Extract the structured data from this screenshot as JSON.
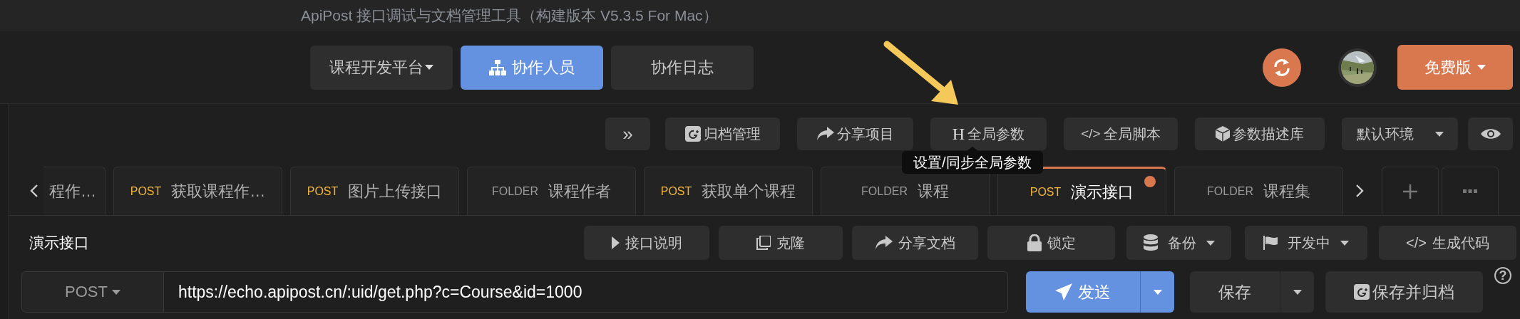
{
  "window": {
    "title": "ApiPost 接口调试与文档管理工具（构建版本 V5.3.5 For Mac）"
  },
  "header": {
    "project_menu": "课程开发平台",
    "buttons": [
      {
        "kind": "members",
        "label": "协作人员",
        "selected": true
      },
      {
        "kind": "log",
        "label": "协作日志",
        "selected": false
      }
    ],
    "plan_button": "免费版"
  },
  "toolbar": [
    {
      "kind": "expand",
      "label": "»"
    },
    {
      "kind": "archive",
      "label": "归档管理"
    },
    {
      "kind": "share",
      "label": "分享项目"
    },
    {
      "kind": "params",
      "glyph": "H",
      "label": "全局参数"
    },
    {
      "kind": "script",
      "glyph": "</>",
      "label": "全局脚本"
    },
    {
      "kind": "library",
      "label": "参数描述库"
    },
    {
      "kind": "environment",
      "label": "默认环境"
    },
    {
      "kind": "visibility"
    }
  ],
  "tooltip": "设置/同步全局参数",
  "tabs": [
    {
      "label": "程作…",
      "selected": false,
      "modified": false
    },
    {
      "kind": "post",
      "method": "POST",
      "label": "获取课程作…",
      "selected": false,
      "modified": false
    },
    {
      "kind": "post",
      "method": "POST",
      "label": "图片上传接口",
      "selected": false,
      "modified": false
    },
    {
      "kind": "folder",
      "method": "FOLDER",
      "label": "课程作者",
      "selected": false,
      "modified": false
    },
    {
      "kind": "post",
      "method": "POST",
      "label": "获取单个课程",
      "selected": false,
      "modified": false
    },
    {
      "kind": "folder",
      "method": "FOLDER",
      "label": "课程",
      "selected": false,
      "modified": false
    },
    {
      "kind": "post",
      "method": "POST",
      "label": "演示接口",
      "selected": true,
      "modified": true
    },
    {
      "kind": "folder",
      "method": "FOLDER",
      "label": "课程集",
      "selected": false,
      "modified": false
    }
  ],
  "request": {
    "title": "演示接口",
    "actions": [
      {
        "kind": "doc",
        "label": "接口说明"
      },
      {
        "kind": "clone",
        "label": "克隆"
      },
      {
        "kind": "share",
        "label": "分享文档"
      },
      {
        "kind": "lock",
        "label": "锁定"
      },
      {
        "kind": "backup",
        "label": "备份"
      },
      {
        "kind": "status",
        "label": "开发中"
      },
      {
        "kind": "code",
        "glyph": "</>",
        "label": "生成代码"
      }
    ],
    "help": "?",
    "method": "POST",
    "url": "https://echo.apipost.cn/:uid/get.php?c=Course&id=1000",
    "send": "发送",
    "save": "保存",
    "save_archive": "保存并归档"
  }
}
